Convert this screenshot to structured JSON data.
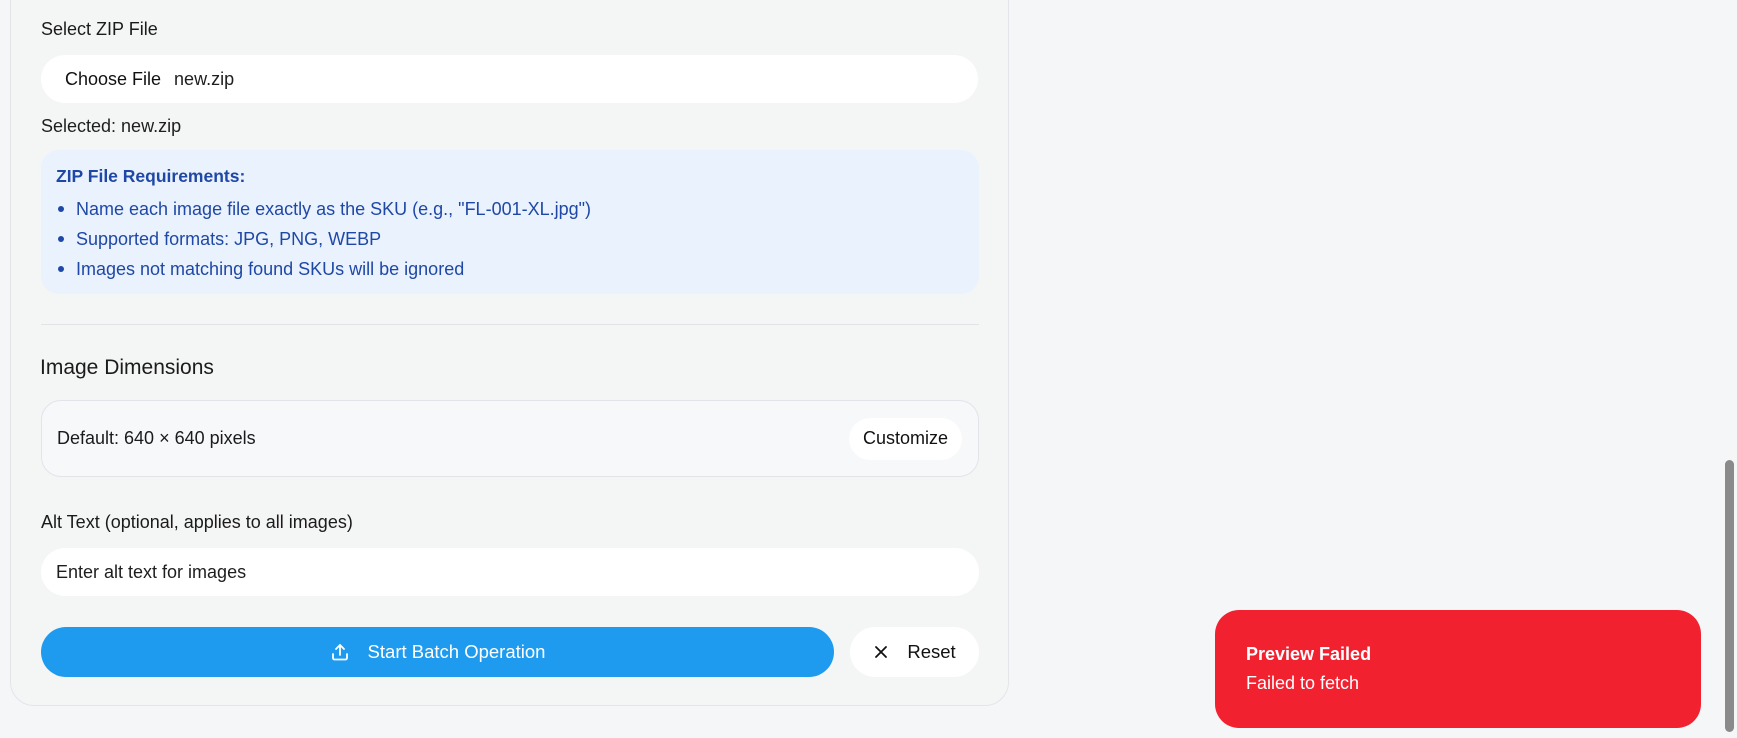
{
  "zip": {
    "label": "Select ZIP File",
    "choose_button": "Choose File",
    "file_name": "new.zip",
    "selected_text": "Selected: new.zip"
  },
  "requirements": {
    "title": "ZIP File Requirements:",
    "items": [
      "Name each image file exactly as the SKU (e.g., \"FL-001-XL.jpg\")",
      "Supported formats: JPG, PNG, WEBP",
      "Images not matching found SKUs will be ignored"
    ]
  },
  "dimensions": {
    "title": "Image Dimensions",
    "default_text": "Default: 640 × 640 pixels",
    "customize_button": "Customize"
  },
  "alt_text": {
    "label": "Alt Text (optional, applies to all images)",
    "placeholder": "Enter alt text for images",
    "value": ""
  },
  "actions": {
    "start_button": "Start Batch Operation",
    "start_icon": "upload-icon",
    "reset_button": "Reset",
    "reset_icon": "close-icon"
  },
  "toast": {
    "title": "Preview Failed",
    "message": "Failed to fetch",
    "color": "#f2212f"
  },
  "colors": {
    "accent": "#1e9bef",
    "info_bg": "#eaf2fd",
    "info_text": "#1f48a6"
  }
}
